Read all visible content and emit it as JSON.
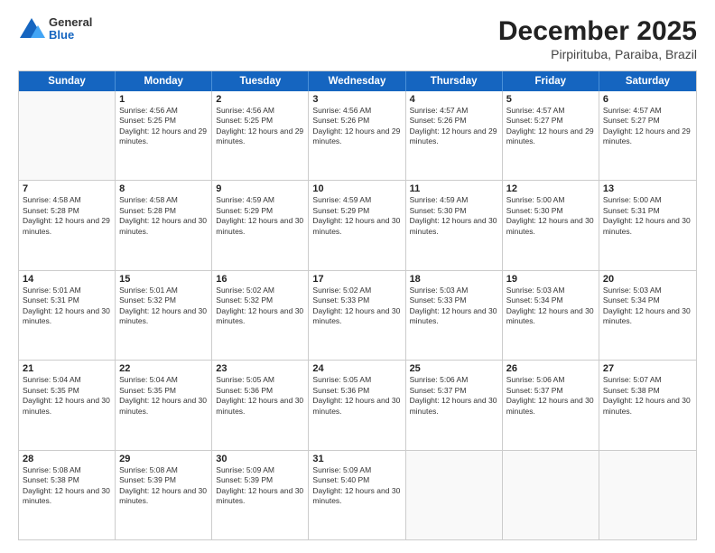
{
  "header": {
    "logo": {
      "line1": "General",
      "line2": "Blue"
    },
    "title": "December 2025",
    "subtitle": "Pirpirituba, Paraiba, Brazil"
  },
  "days_of_week": [
    "Sunday",
    "Monday",
    "Tuesday",
    "Wednesday",
    "Thursday",
    "Friday",
    "Saturday"
  ],
  "weeks": [
    [
      {
        "day": "",
        "info": ""
      },
      {
        "day": "1",
        "sunrise": "4:56 AM",
        "sunset": "5:25 PM",
        "daylight": "12 hours and 29 minutes."
      },
      {
        "day": "2",
        "sunrise": "4:56 AM",
        "sunset": "5:25 PM",
        "daylight": "12 hours and 29 minutes."
      },
      {
        "day": "3",
        "sunrise": "4:56 AM",
        "sunset": "5:26 PM",
        "daylight": "12 hours and 29 minutes."
      },
      {
        "day": "4",
        "sunrise": "4:57 AM",
        "sunset": "5:26 PM",
        "daylight": "12 hours and 29 minutes."
      },
      {
        "day": "5",
        "sunrise": "4:57 AM",
        "sunset": "5:27 PM",
        "daylight": "12 hours and 29 minutes."
      },
      {
        "day": "6",
        "sunrise": "4:57 AM",
        "sunset": "5:27 PM",
        "daylight": "12 hours and 29 minutes."
      }
    ],
    [
      {
        "day": "7",
        "sunrise": "4:58 AM",
        "sunset": "5:28 PM",
        "daylight": "12 hours and 29 minutes."
      },
      {
        "day": "8",
        "sunrise": "4:58 AM",
        "sunset": "5:28 PM",
        "daylight": "12 hours and 30 minutes."
      },
      {
        "day": "9",
        "sunrise": "4:59 AM",
        "sunset": "5:29 PM",
        "daylight": "12 hours and 30 minutes."
      },
      {
        "day": "10",
        "sunrise": "4:59 AM",
        "sunset": "5:29 PM",
        "daylight": "12 hours and 30 minutes."
      },
      {
        "day": "11",
        "sunrise": "4:59 AM",
        "sunset": "5:30 PM",
        "daylight": "12 hours and 30 minutes."
      },
      {
        "day": "12",
        "sunrise": "5:00 AM",
        "sunset": "5:30 PM",
        "daylight": "12 hours and 30 minutes."
      },
      {
        "day": "13",
        "sunrise": "5:00 AM",
        "sunset": "5:31 PM",
        "daylight": "12 hours and 30 minutes."
      }
    ],
    [
      {
        "day": "14",
        "sunrise": "5:01 AM",
        "sunset": "5:31 PM",
        "daylight": "12 hours and 30 minutes."
      },
      {
        "day": "15",
        "sunrise": "5:01 AM",
        "sunset": "5:32 PM",
        "daylight": "12 hours and 30 minutes."
      },
      {
        "day": "16",
        "sunrise": "5:02 AM",
        "sunset": "5:32 PM",
        "daylight": "12 hours and 30 minutes."
      },
      {
        "day": "17",
        "sunrise": "5:02 AM",
        "sunset": "5:33 PM",
        "daylight": "12 hours and 30 minutes."
      },
      {
        "day": "18",
        "sunrise": "5:03 AM",
        "sunset": "5:33 PM",
        "daylight": "12 hours and 30 minutes."
      },
      {
        "day": "19",
        "sunrise": "5:03 AM",
        "sunset": "5:34 PM",
        "daylight": "12 hours and 30 minutes."
      },
      {
        "day": "20",
        "sunrise": "5:03 AM",
        "sunset": "5:34 PM",
        "daylight": "12 hours and 30 minutes."
      }
    ],
    [
      {
        "day": "21",
        "sunrise": "5:04 AM",
        "sunset": "5:35 PM",
        "daylight": "12 hours and 30 minutes."
      },
      {
        "day": "22",
        "sunrise": "5:04 AM",
        "sunset": "5:35 PM",
        "daylight": "12 hours and 30 minutes."
      },
      {
        "day": "23",
        "sunrise": "5:05 AM",
        "sunset": "5:36 PM",
        "daylight": "12 hours and 30 minutes."
      },
      {
        "day": "24",
        "sunrise": "5:05 AM",
        "sunset": "5:36 PM",
        "daylight": "12 hours and 30 minutes."
      },
      {
        "day": "25",
        "sunrise": "5:06 AM",
        "sunset": "5:37 PM",
        "daylight": "12 hours and 30 minutes."
      },
      {
        "day": "26",
        "sunrise": "5:06 AM",
        "sunset": "5:37 PM",
        "daylight": "12 hours and 30 minutes."
      },
      {
        "day": "27",
        "sunrise": "5:07 AM",
        "sunset": "5:38 PM",
        "daylight": "12 hours and 30 minutes."
      }
    ],
    [
      {
        "day": "28",
        "sunrise": "5:08 AM",
        "sunset": "5:38 PM",
        "daylight": "12 hours and 30 minutes."
      },
      {
        "day": "29",
        "sunrise": "5:08 AM",
        "sunset": "5:39 PM",
        "daylight": "12 hours and 30 minutes."
      },
      {
        "day": "30",
        "sunrise": "5:09 AM",
        "sunset": "5:39 PM",
        "daylight": "12 hours and 30 minutes."
      },
      {
        "day": "31",
        "sunrise": "5:09 AM",
        "sunset": "5:40 PM",
        "daylight": "12 hours and 30 minutes."
      },
      {
        "day": "",
        "info": ""
      },
      {
        "day": "",
        "info": ""
      },
      {
        "day": "",
        "info": ""
      }
    ]
  ]
}
